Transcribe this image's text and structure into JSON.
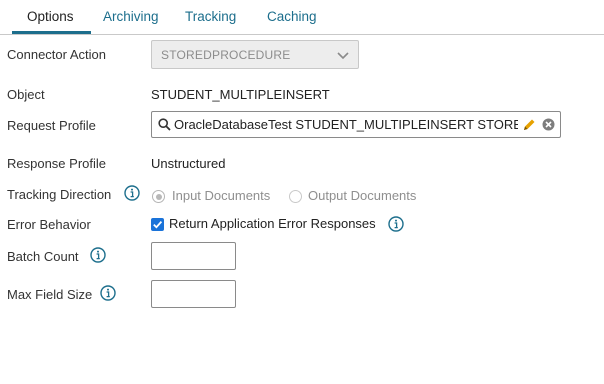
{
  "tabs": [
    {
      "label": "Options",
      "active": true
    },
    {
      "label": "Archiving",
      "active": false
    },
    {
      "label": "Tracking",
      "active": false
    },
    {
      "label": "Caching",
      "active": false
    }
  ],
  "form": {
    "connector_action": {
      "label": "Connector Action",
      "value": "STOREDPROCEDURE"
    },
    "object": {
      "label": "Object",
      "value": "STUDENT_MULTIPLEINSERT"
    },
    "request_profile": {
      "label": "Request Profile",
      "value": "OracleDatabaseTest STUDENT_MULTIPLEINSERT STOREDPROCEDURE"
    },
    "response_profile": {
      "label": "Response Profile",
      "value": "Unstructured"
    },
    "tracking_direction": {
      "label": "Tracking Direction",
      "options": [
        {
          "label": "Input Documents",
          "selected": true
        },
        {
          "label": "Output Documents",
          "selected": false
        }
      ]
    },
    "error_behavior": {
      "label": "Error Behavior",
      "checkbox_label": "Return Application Error Responses",
      "checked": true
    },
    "batch_count": {
      "label": "Batch Count",
      "value": ""
    },
    "max_field_size": {
      "label": "Max Field Size",
      "value": ""
    }
  },
  "icons": {
    "info": "info-circle-icon",
    "search": "search-icon",
    "edit": "pencil-icon",
    "clear": "clear-circle-icon",
    "dropdown": "chevron-down-icon"
  },
  "colors": {
    "accent": "#1c6e8c",
    "checkbox": "#1a73d9",
    "pencil": "#e6a100",
    "disabled_bg": "#ededed"
  }
}
